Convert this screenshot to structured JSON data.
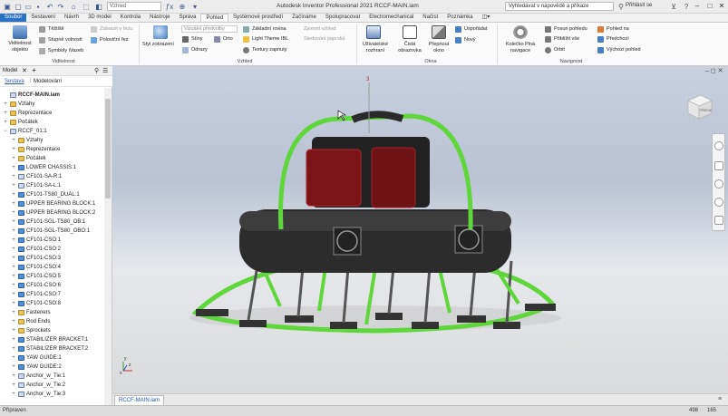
{
  "app": {
    "title": "Autodesk Inventor Professional 2021   RCCF-MAIN.iam",
    "view_combo": "Vzhled",
    "help_search": "Vyhledávat v nápovědě a příkaze",
    "login": "Přihlásit se",
    "winbtns": [
      "–",
      "□",
      "✕"
    ]
  },
  "tabs": [
    "Soubor",
    "Sestavení",
    "Návrh",
    "3D model",
    "Kontrola",
    "Nástroje",
    "Správa",
    "Pohled",
    "Systémové prostředí",
    "Začínáme",
    "Spolupracovat",
    "Electromechanical",
    "Načíst",
    "Poznámka"
  ],
  "active_tab": "Pohled",
  "ribbon": {
    "visibility": {
      "big": "Viditelnost objektu",
      "small": [
        "Těžiště",
        "Stupně volnosti",
        "Symboly iVazeb"
      ],
      "dim": [
        "Zobrazit v řezu"
      ],
      "extra": "Poloviční řez",
      "label": "Viditelnost"
    },
    "appearance": {
      "big": "Styl zobrazení",
      "combo": "Vizuální předvolby",
      "items": [
        "Stíny",
        "Ortografický",
        "Odrazy",
        "Základní rovina",
        "Light Theme IBL",
        "Textury zapnuty"
      ],
      "dim": [
        "Zjemnit vzhled",
        "Sledování paprsků"
      ],
      "ortho_short": "Orto",
      "label": "Vzhled"
    },
    "window": {
      "items": [
        "Uživatelské rozhraní",
        "Čistá obrazovka",
        "Přepnout okno",
        "Uspořádat",
        "Nový"
      ],
      "label": "Okna"
    },
    "navigate": {
      "big": "Kolečko Plná navigace",
      "items": [
        "Posun pohledu",
        "Přiblížit vše",
        "Orbit",
        "Pohled na",
        "Předchozí",
        "Výchozí pohled"
      ],
      "label": "Navigovat"
    }
  },
  "panel": {
    "title": "Model",
    "close": "✕",
    "add": "+",
    "search_icon": "search-icon",
    "menu_icon": "menu-icon",
    "subtabs": [
      "Sestava",
      "Modelování"
    ]
  },
  "tree": [
    {
      "label": "RCCF-MAIN.iam",
      "icon": "asm",
      "level": 0,
      "exp": "",
      "bold": true
    },
    {
      "label": "Vztahy",
      "icon": "folder",
      "level": 0,
      "exp": "+"
    },
    {
      "label": "Reprezentace",
      "icon": "folder",
      "level": 0,
      "exp": "+"
    },
    {
      "label": "Počátek",
      "icon": "folder",
      "level": 0,
      "exp": "+"
    },
    {
      "label": "RCCF_01:1",
      "icon": "asm",
      "level": 0,
      "exp": "−"
    },
    {
      "label": "Vztahy",
      "icon": "folder",
      "level": 1,
      "exp": "+"
    },
    {
      "label": "Reprezentace",
      "icon": "folder",
      "level": 1,
      "exp": "+"
    },
    {
      "label": "Počátek",
      "icon": "folder",
      "level": 1,
      "exp": "+"
    },
    {
      "label": "LOWER CHASSIS:1",
      "icon": "part",
      "level": 1,
      "exp": "+"
    },
    {
      "label": "CF101-SA-R:1",
      "icon": "asm",
      "level": 1,
      "exp": "+"
    },
    {
      "label": "CF101-SA-L:1",
      "icon": "asm",
      "level": 1,
      "exp": "+"
    },
    {
      "label": "CF101-TS80_DUAL:1",
      "icon": "part",
      "level": 1,
      "exp": "+"
    },
    {
      "label": "UPPER BEARING BLOCK:1",
      "icon": "part",
      "level": 1,
      "exp": "+"
    },
    {
      "label": "UPPER BEARING BLOCK:2",
      "icon": "part",
      "level": 1,
      "exp": "+"
    },
    {
      "label": "CF101-SGL-TS80_OB:1",
      "icon": "part",
      "level": 1,
      "exp": "+"
    },
    {
      "label": "CF101-SGL-TS80_OBO:1",
      "icon": "part",
      "level": 1,
      "exp": "+"
    },
    {
      "label": "CF101-CSO:1",
      "icon": "part",
      "level": 1,
      "exp": "+"
    },
    {
      "label": "CF101-CSO:2",
      "icon": "part",
      "level": 1,
      "exp": "+"
    },
    {
      "label": "CF101-CSO:3",
      "icon": "part",
      "level": 1,
      "exp": "+"
    },
    {
      "label": "CF101-CSO:4",
      "icon": "part",
      "level": 1,
      "exp": "+"
    },
    {
      "label": "CF101-CSO:5",
      "icon": "part",
      "level": 1,
      "exp": "+"
    },
    {
      "label": "CF101-CSO:6",
      "icon": "part",
      "level": 1,
      "exp": "+"
    },
    {
      "label": "CF101-CSO:7",
      "icon": "part",
      "level": 1,
      "exp": "+"
    },
    {
      "label": "CF101-CSO:8",
      "icon": "part",
      "level": 1,
      "exp": "+"
    },
    {
      "label": "Fasteners",
      "icon": "folder",
      "level": 1,
      "exp": "+"
    },
    {
      "label": "Rod Ends",
      "icon": "folder",
      "level": 1,
      "exp": "+"
    },
    {
      "label": "Sprockets",
      "icon": "folder",
      "level": 1,
      "exp": "+"
    },
    {
      "label": "STABILIZER BRACKET:1",
      "icon": "part",
      "level": 1,
      "exp": "+"
    },
    {
      "label": "STABILIZER BRACKET:2",
      "icon": "part",
      "level": 1,
      "exp": "+"
    },
    {
      "label": "YAW GUIDE:1",
      "icon": "part",
      "level": 1,
      "exp": "+"
    },
    {
      "label": "YAW GUIDE:2",
      "icon": "part",
      "level": 1,
      "exp": "+"
    },
    {
      "label": "Anchor_w_Tie:1",
      "icon": "asm",
      "level": 1,
      "exp": "+"
    },
    {
      "label": "Anchor_w_Tie:2",
      "icon": "asm",
      "level": 1,
      "exp": "+"
    },
    {
      "label": "Anchor_w_Tie:3",
      "icon": "asm",
      "level": 1,
      "exp": "+"
    }
  ],
  "viewport": {
    "viewcube_label": "PŘEDNÍ",
    "axis_x": "x",
    "axis_y": "y",
    "axis_z": "z",
    "marker": "3"
  },
  "doc_tab": "RCCF-MAIN.iam",
  "status": {
    "text": "Připraven",
    "n1": "498",
    "n2": "165"
  },
  "colors": {
    "file_tab": "#2a72c5",
    "frame_green": "#5fd63a",
    "body": "#2b2b2b",
    "motor_red": "#7a1418"
  }
}
